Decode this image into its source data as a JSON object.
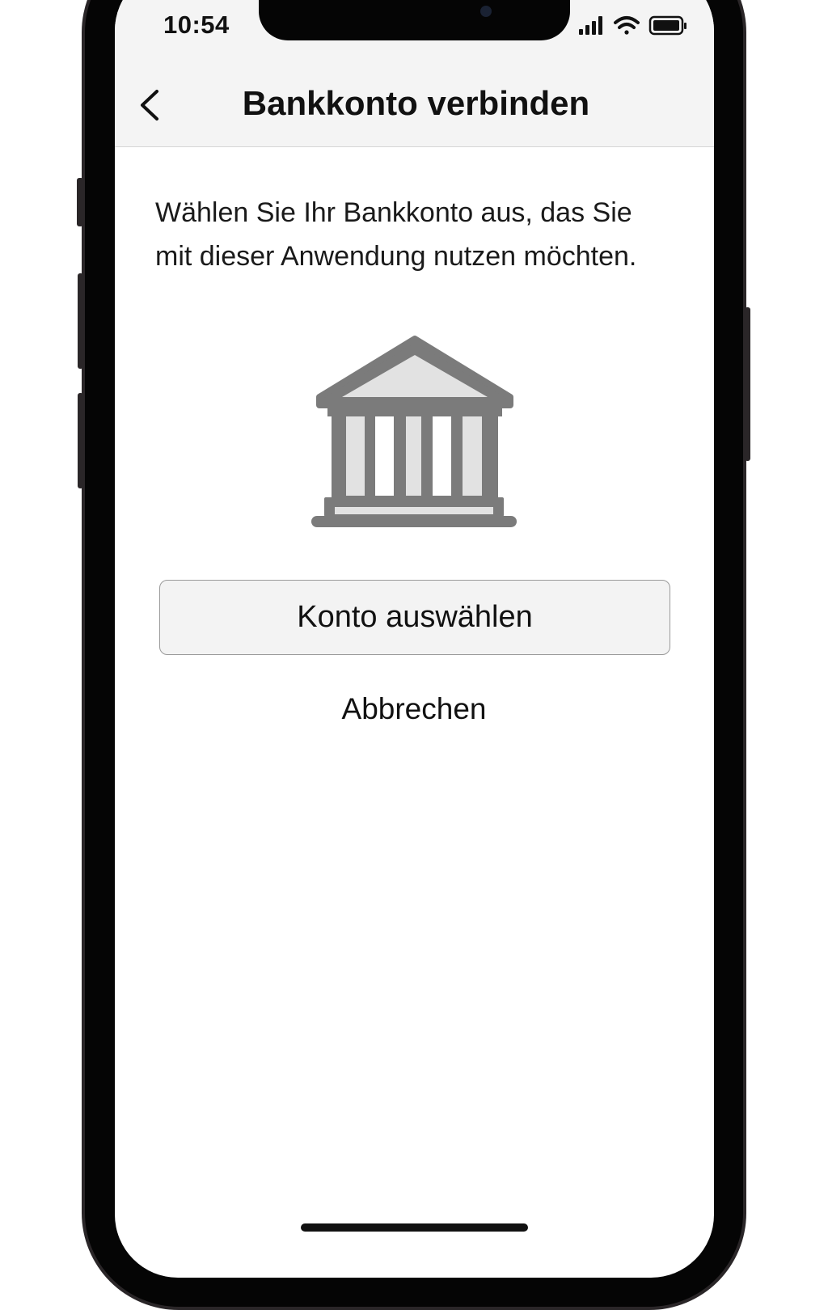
{
  "status_bar": {
    "time": "10:54",
    "icons": [
      "signal-icon",
      "wifi-icon",
      "battery-icon"
    ]
  },
  "nav": {
    "back_icon": "chevron-left-icon",
    "title": "Bankkonto verbinden"
  },
  "content": {
    "description_line1": "Wählen Sie Ihr Bankkonto aus, das Sie",
    "description_line2": "mit dieser Anwendung nutzen möchten.",
    "illustration_icon": "bank-building-icon",
    "primary_button_label": "Konto auswählen",
    "cancel_label": "Abbrechen"
  },
  "colors": {
    "icon_stroke": "#7b7b7b",
    "icon_fill": "#e2e2e2",
    "header_bg": "#f4f4f4",
    "button_bg": "#f3f3f3"
  }
}
